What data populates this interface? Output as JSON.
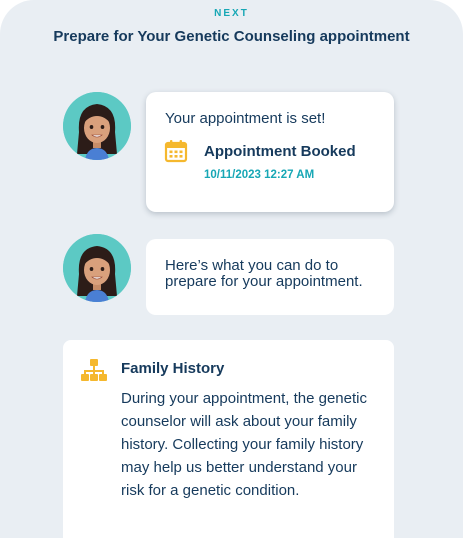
{
  "header": {
    "next_label": "NEXT",
    "title": "Prepare for Your Genetic Counseling appointment"
  },
  "messages": [
    {
      "text": "Your appointment is set!",
      "event_icon": "calendar-icon",
      "event_title": "Appointment Booked",
      "event_time": "10/11/2023 12:27 AM"
    },
    {
      "text": "Here’s what you can do to prepare for your appointment."
    }
  ],
  "card": {
    "icon": "family-tree-icon",
    "title": "Family History",
    "body": "During your appointment, the genetic counselor will ask about your family history. Collecting your family history may help us better understand your risk for a genetic condition."
  },
  "colors": {
    "background": "#e9eef3",
    "navy_text": "#163a5c",
    "teal_accent": "#17a7b5",
    "icon_yellow": "#f5b82e",
    "avatar_bg": "#5cc9c4"
  }
}
